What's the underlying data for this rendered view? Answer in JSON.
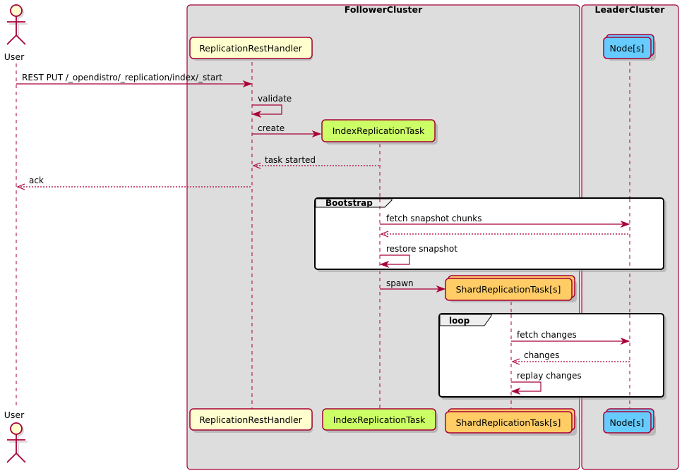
{
  "diagram": {
    "type": "sequence",
    "colors": {
      "line": "#A80036",
      "cluster_bg": "#DDDDDD",
      "actor_fill": "#FEFECE",
      "rest_handler": "#FEFECE",
      "index_task": "#CCFF66",
      "shard_task": "#FFCC66",
      "node": "#66CCFF"
    },
    "clusters": [
      {
        "id": "follower",
        "title": "FollowerCluster"
      },
      {
        "id": "leader",
        "title": "LeaderCluster"
      }
    ],
    "participants": [
      {
        "id": "user",
        "label": "User",
        "kind": "actor"
      },
      {
        "id": "rest",
        "label": "ReplicationRestHandler",
        "kind": "participant",
        "cluster": "follower"
      },
      {
        "id": "irt",
        "label": "IndexReplicationTask",
        "kind": "participant",
        "cluster": "follower",
        "created": true
      },
      {
        "id": "srt",
        "label": "ShardReplicationTask[s]",
        "kind": "collections",
        "cluster": "follower",
        "created": true
      },
      {
        "id": "node",
        "label": "Node[s]",
        "kind": "collections",
        "cluster": "leader"
      }
    ],
    "messages": [
      {
        "from": "user",
        "to": "rest",
        "label": "REST PUT /_opendistro/_replication/index/_start",
        "style": "solid"
      },
      {
        "from": "rest",
        "to": "rest",
        "label": "validate",
        "style": "self"
      },
      {
        "from": "rest",
        "to": "irt",
        "label": "create",
        "style": "create"
      },
      {
        "from": "irt",
        "to": "rest",
        "label": "task started",
        "style": "dashed"
      },
      {
        "from": "rest",
        "to": "user",
        "label": "ack",
        "style": "dashed"
      },
      {
        "from": "irt",
        "to": "node",
        "label": "fetch snapshot chunks",
        "style": "solid",
        "group": "Bootstrap"
      },
      {
        "from": "node",
        "to": "irt",
        "label": "",
        "style": "dashed",
        "group": "Bootstrap"
      },
      {
        "from": "irt",
        "to": "irt",
        "label": "restore snapshot",
        "style": "self",
        "group": "Bootstrap"
      },
      {
        "from": "irt",
        "to": "srt",
        "label": "spawn",
        "style": "create"
      },
      {
        "from": "srt",
        "to": "node",
        "label": "fetch changes",
        "style": "solid",
        "group": "loop"
      },
      {
        "from": "node",
        "to": "srt",
        "label": "changes",
        "style": "dashed",
        "group": "loop"
      },
      {
        "from": "srt",
        "to": "srt",
        "label": "replay changes",
        "style": "self",
        "group": "loop"
      }
    ],
    "groups": [
      {
        "label": "Bootstrap"
      },
      {
        "label": "loop"
      }
    ]
  }
}
